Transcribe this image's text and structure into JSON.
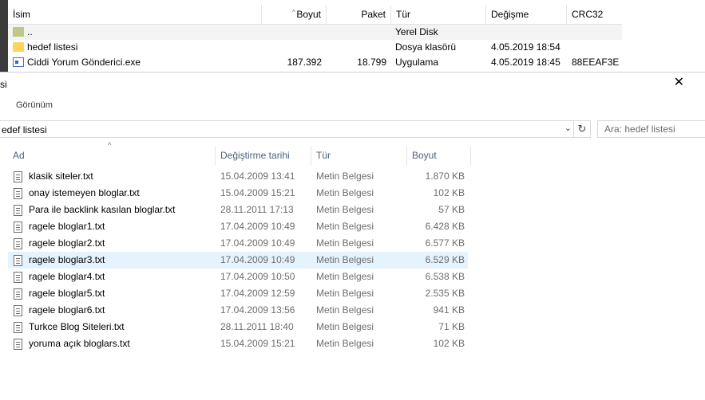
{
  "archive": {
    "columns": {
      "name": "İsim",
      "size": "Boyut",
      "packed": "Paket",
      "type": "Tür",
      "modified": "Değişme",
      "crc": "CRC32"
    },
    "rows": [
      {
        "name": "..",
        "size": "",
        "packed": "",
        "type": "Yerel Disk",
        "modified": "",
        "crc": "",
        "icon": "folder-up-icon"
      },
      {
        "name": "hedef listesi",
        "size": "",
        "packed": "",
        "type": "Dosya klasörü",
        "modified": "4.05.2019 18:54",
        "crc": "",
        "icon": "folder-icon"
      },
      {
        "name": "Ciddi Yorum Gönderici.exe",
        "size": "187.392",
        "packed": "18.799",
        "type": "Uygulama",
        "modified": "4.05.2019 18:45",
        "crc": "88EEAF3E",
        "icon": "exe-icon"
      }
    ]
  },
  "explorer": {
    "title": "si",
    "close": "✕",
    "ribbon_tab": "Görünüm",
    "address": "edef listesi",
    "search_placeholder": "Ara: hedef listesi",
    "columns": {
      "name": "Ad",
      "date": "Değiştirme tarihi",
      "type": "Tür",
      "size": "Boyut"
    },
    "files": [
      {
        "name": "klasik siteler.txt",
        "date": "15.04.2009 13:41",
        "type": "Metin Belgesi",
        "size": "1.870 KB"
      },
      {
        "name": "onay istemeyen bloglar.txt",
        "date": "15.04.2009 15:21",
        "type": "Metin Belgesi",
        "size": "102 KB"
      },
      {
        "name": "Para ile backlink kasılan bloglar.txt",
        "date": "28.11.2011 17:13",
        "type": "Metin Belgesi",
        "size": "57 KB"
      },
      {
        "name": "ragele bloglar1.txt",
        "date": "17.04.2009 10:49",
        "type": "Metin Belgesi",
        "size": "6.428 KB"
      },
      {
        "name": "ragele bloglar2.txt",
        "date": "17.04.2009 10:49",
        "type": "Metin Belgesi",
        "size": "6.577 KB"
      },
      {
        "name": "ragele bloglar3.txt",
        "date": "17.04.2009 10:49",
        "type": "Metin Belgesi",
        "size": "6.529 KB"
      },
      {
        "name": "ragele bloglar4.txt",
        "date": "17.04.2009 10:50",
        "type": "Metin Belgesi",
        "size": "6.538 KB"
      },
      {
        "name": "ragele bloglar5.txt",
        "date": "17.04.2009 12:59",
        "type": "Metin Belgesi",
        "size": "2.535 KB"
      },
      {
        "name": "ragele bloglar6.txt",
        "date": "17.04.2009 13:56",
        "type": "Metin Belgesi",
        "size": "941 KB"
      },
      {
        "name": "Turkce Blog Siteleri.txt",
        "date": "28.11.2011 18:40",
        "type": "Metin Belgesi",
        "size": "71 KB"
      },
      {
        "name": "yoruma açık bloglars.txt",
        "date": "15.04.2009 15:21",
        "type": "Metin Belgesi",
        "size": "102 KB"
      }
    ]
  },
  "colors": {
    "hover_row": "#e5f3ff",
    "header_text": "#4c607a",
    "meta_text": "#6d6d6d",
    "folder": "#ffd45e"
  }
}
